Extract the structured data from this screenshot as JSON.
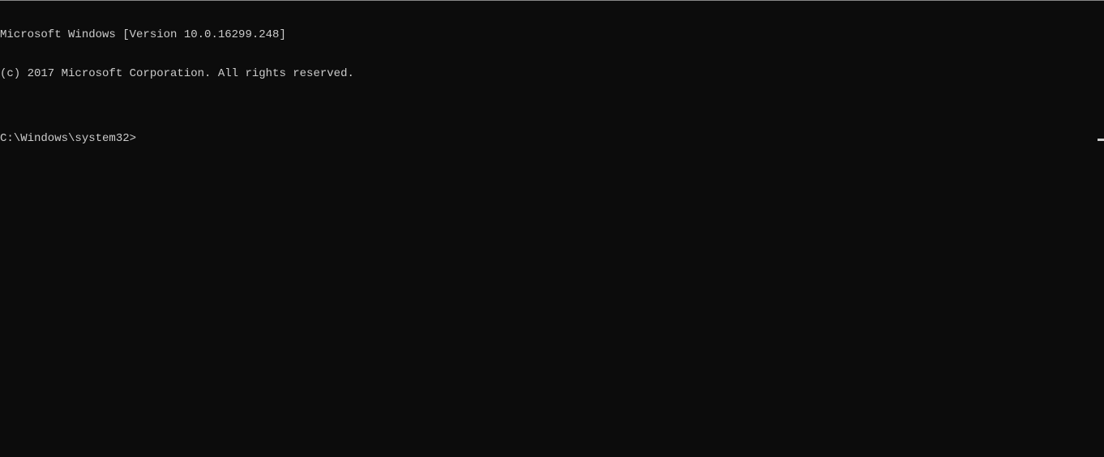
{
  "terminal": {
    "version_line": "Microsoft Windows [Version 10.0.16299.248]",
    "copyright_line": "(c) 2017 Microsoft Corporation. All rights reserved.",
    "blank_line": "",
    "prompt": "C:\\Windows\\system32>",
    "input_value": ""
  }
}
